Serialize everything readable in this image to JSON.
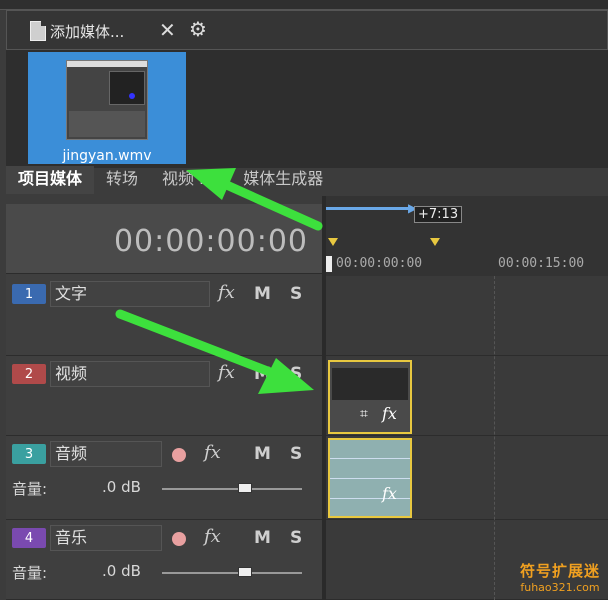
{
  "media_toolbar": {
    "add_media_label": "添加媒体...",
    "close_icon": "close-icon",
    "settings_icon": "gear-icon"
  },
  "media": {
    "items": [
      {
        "name": "jingyan.wmv"
      }
    ]
  },
  "tabs": [
    {
      "label": "项目媒体",
      "active": true
    },
    {
      "label": "转场",
      "active": false
    },
    {
      "label": "视频 FX",
      "active": false
    },
    {
      "label": "媒体生成器",
      "active": false
    }
  ],
  "timecode": "00:00:00:00",
  "ruler": {
    "loop_length": "+7:13",
    "tick_0": "00:00:00:00",
    "tick_1": "00:00:15:00"
  },
  "tracks": [
    {
      "num": "1",
      "name": "文字",
      "fx": "fx",
      "mute": "M",
      "solo": "S",
      "color": "#3a6ab0"
    },
    {
      "num": "2",
      "name": "视频",
      "fx": "fx",
      "mute": "M",
      "solo": "S",
      "color": "#b04a4a"
    },
    {
      "num": "3",
      "name": "音频",
      "fx": "fx",
      "mute": "M",
      "solo": "S",
      "color": "#3aa0a0",
      "volume_label": "音量:",
      "volume_value": ".0 dB"
    },
    {
      "num": "4",
      "name": "音乐",
      "fx": "fx",
      "mute": "M",
      "solo": "S",
      "color": "#7a4ab0",
      "volume_label": "音量:",
      "volume_value": ".0 dB"
    }
  ],
  "clips": {
    "video_fx": "fx",
    "audio_fx": "fx"
  },
  "watermark": {
    "cn": "符号扩展迷",
    "en": "fuhao321.com"
  },
  "colors": {
    "accent_blue": "#3b8ed8",
    "clip_border": "#e8c840",
    "arrow_green": "#3de03d"
  }
}
